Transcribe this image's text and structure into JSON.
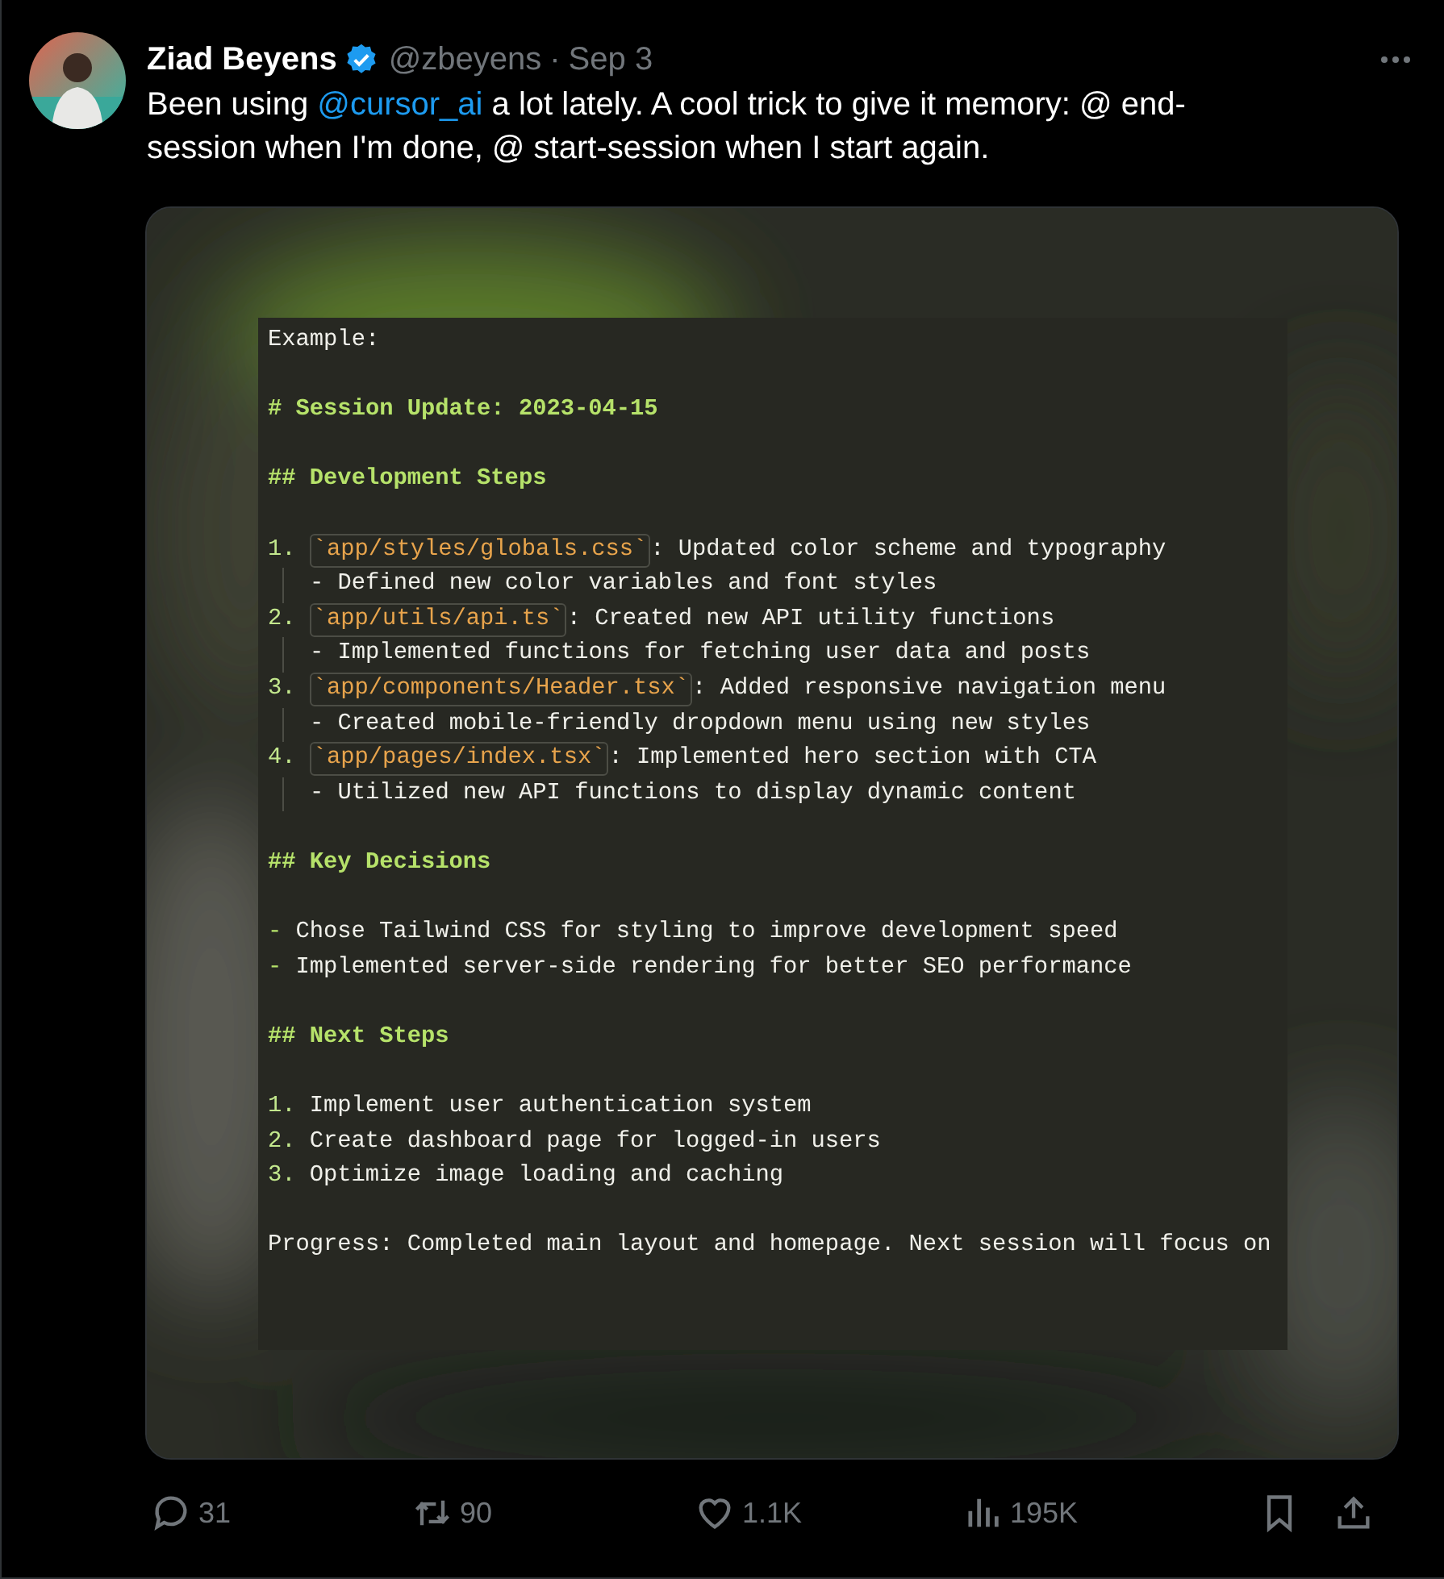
{
  "tweet": {
    "author": {
      "name": "Ziad Beyens",
      "verified": true,
      "handle": "@zbeyens",
      "separator": "·",
      "date": "Sep 3"
    },
    "text": {
      "before": "Been using ",
      "mention": "@cursor_ai",
      "after": " a lot lately. A cool trick to give it memory: @ end-session when I'm done, @ start-session when I start again."
    },
    "media": {
      "lines": [
        {
          "kind": "text",
          "text": "Example:"
        },
        {
          "kind": "blank"
        },
        {
          "kind": "heading",
          "text": "# Session Update: 2023-04-15"
        },
        {
          "kind": "blank"
        },
        {
          "kind": "heading",
          "text": "## Development Steps"
        },
        {
          "kind": "blank"
        },
        {
          "kind": "numbered",
          "number": "1.",
          "code": "`app/styles/globals.css`",
          "text": ": Updated color scheme and typography"
        },
        {
          "kind": "sub",
          "text": "- Defined new color variables and font styles"
        },
        {
          "kind": "numbered",
          "number": "2.",
          "code": "`app/utils/api.ts`",
          "text": ": Created new API utility functions"
        },
        {
          "kind": "sub",
          "text": "- Implemented functions for fetching user data and posts"
        },
        {
          "kind": "numbered",
          "number": "3.",
          "code": "`app/components/Header.tsx`",
          "text": ": Added responsive navigation menu"
        },
        {
          "kind": "sub",
          "text": "- Created mobile-friendly dropdown menu using new styles"
        },
        {
          "kind": "numbered",
          "number": "4.",
          "code": "`app/pages/index.tsx`",
          "text": ": Implemented hero section with CTA"
        },
        {
          "kind": "sub",
          "text": "- Utilized new API functions to display dynamic content"
        },
        {
          "kind": "blank"
        },
        {
          "kind": "heading",
          "text": "## Key Decisions"
        },
        {
          "kind": "blank"
        },
        {
          "kind": "bullet",
          "marker": "-",
          "text": "Chose Tailwind CSS for styling to improve development speed"
        },
        {
          "kind": "bullet",
          "marker": "-",
          "text": "Implemented server-side rendering for better SEO performance"
        },
        {
          "kind": "blank"
        },
        {
          "kind": "heading",
          "text": "## Next Steps"
        },
        {
          "kind": "blank"
        },
        {
          "kind": "numbered",
          "number": "1.",
          "text": "Implement user authentication system"
        },
        {
          "kind": "numbered",
          "number": "2.",
          "text": "Create dashboard page for logged-in users"
        },
        {
          "kind": "numbered",
          "number": "3.",
          "text": "Optimize image loading and caching"
        },
        {
          "kind": "blank"
        },
        {
          "kind": "text",
          "text": "Progress: Completed main layout and homepage. Next session will focus on"
        }
      ]
    },
    "actions": [
      {
        "kind": "reply",
        "count": "31"
      },
      {
        "kind": "repost",
        "count": "90"
      },
      {
        "kind": "like",
        "count": "1.1K"
      },
      {
        "kind": "views",
        "count": "195K"
      },
      {
        "kind": "bookmark"
      },
      {
        "kind": "share"
      }
    ]
  }
}
